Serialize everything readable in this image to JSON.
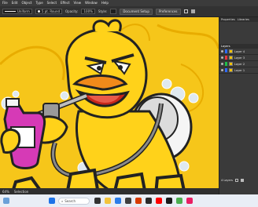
{
  "menu": [
    "File",
    "Edit",
    "Object",
    "Type",
    "Select",
    "Effect",
    "View",
    "Window",
    "Help"
  ],
  "control_bar": {
    "stroke_style_label": "Uniform",
    "brush_label": "5 pt. Round",
    "opacity_label": "Opacity:",
    "opacity_value": "100%",
    "style_label": "Style:",
    "doc_setup_button": "Document Setup",
    "preferences_button": "Preferences"
  },
  "panel": {
    "tabs": [
      "Properties",
      "Libraries"
    ],
    "layers_tab": "Layers",
    "layers": [
      {
        "name": "Layer 4",
        "color": "#2f6bff"
      },
      {
        "name": "Layer 3",
        "color": "#e8363d"
      },
      {
        "name": "Layer 2",
        "color": "#1fbf4a"
      },
      {
        "name": "Layer 1",
        "color": "#2f6bff"
      }
    ],
    "footer_label": "4 Layers"
  },
  "status": {
    "zoom": "64%",
    "tool": "Selection"
  },
  "taskbar": {
    "search_placeholder": "Search"
  },
  "colors": {
    "canvas_bg": "#f6c61a",
    "duck_yellow": "#ffd21a",
    "beak_orange": "#f08a1a",
    "bottle_magenta": "#d63ab6",
    "taskbar_bg": "#e9eef6"
  }
}
